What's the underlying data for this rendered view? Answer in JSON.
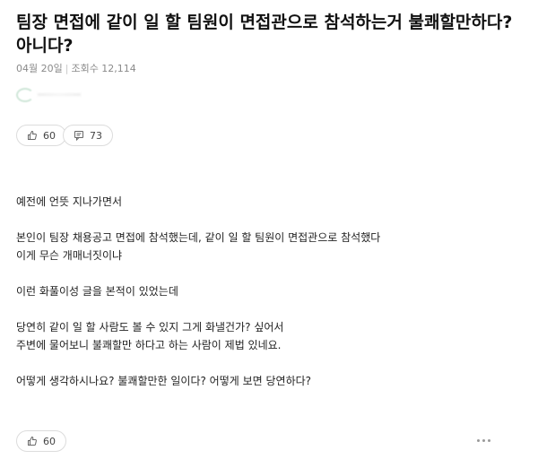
{
  "post": {
    "title": "팀장 면접에 같이 일 할 팀원이 면접관으로 참석하는거 불쾌할만하다? 아니다?",
    "date": "04월 20일",
    "separator": "|",
    "views": "조회수 12,114",
    "likes": "60",
    "comments": "73",
    "paragraphs": [
      [
        "예전에 언뜻 지나가면서"
      ],
      [
        "본인이 팀장 채용공고 면접에 참석했는데, 같이 일 할 팀원이 면접관으로 참석했다",
        "이게 무슨 개매너짓이냐"
      ],
      [
        "이런 화풀이성 글을 본적이 있었는데"
      ],
      [
        "당연히 같이 일 할 사람도 볼 수 있지 그게 화낼건가? 싶어서",
        "주변에 물어보니 불쾌할만 하다고 하는 사람이 제법 있네요."
      ],
      [
        "어떻게 생각하시나요? 불쾌할만한 일이다? 어떻게 보면 당연하다?"
      ]
    ],
    "bottom_likes": "60"
  },
  "icons": {
    "like": "thumbs-up-icon",
    "comment": "comment-icon",
    "more": "more-dots-icon"
  }
}
